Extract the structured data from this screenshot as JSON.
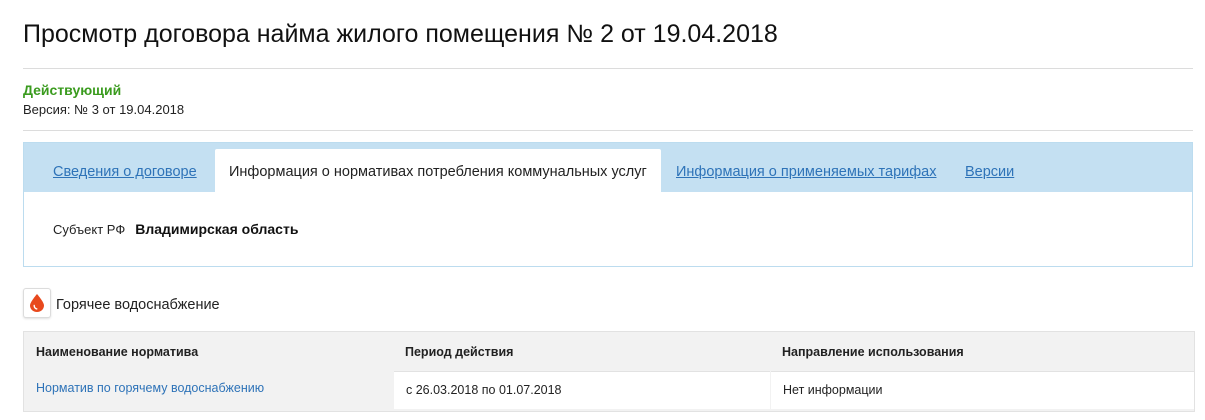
{
  "page": {
    "title": "Просмотр договора найма жилого помещения № 2 от 19.04.2018",
    "status": "Действующий",
    "version": "Версия: № 3 от 19.04.2018"
  },
  "tabs": [
    {
      "label": "Сведения о договоре",
      "active": false
    },
    {
      "label": "Информация о нормативах потребления коммунальных услуг",
      "active": true
    },
    {
      "label": "Информация о применяемых тарифах",
      "active": false
    },
    {
      "label": "Версии",
      "active": false
    }
  ],
  "subject": {
    "label": "Субъект РФ",
    "value": "Владимирская область"
  },
  "service": {
    "icon": "water-drop-icon",
    "icon_color": "#e8491d",
    "label": "Горячее водоснабжение"
  },
  "table": {
    "headers": [
      "Наименование норматива",
      "Период действия",
      "Направление использования"
    ],
    "rows": [
      [
        "Норматив по горячему водоснабжению",
        "с 26.03.2018 по 01.07.2018",
        "Нет информации"
      ]
    ]
  },
  "colors": {
    "status": "#3a9b1e",
    "link": "#2e73b8",
    "tabbar": "#c4e0f2"
  }
}
